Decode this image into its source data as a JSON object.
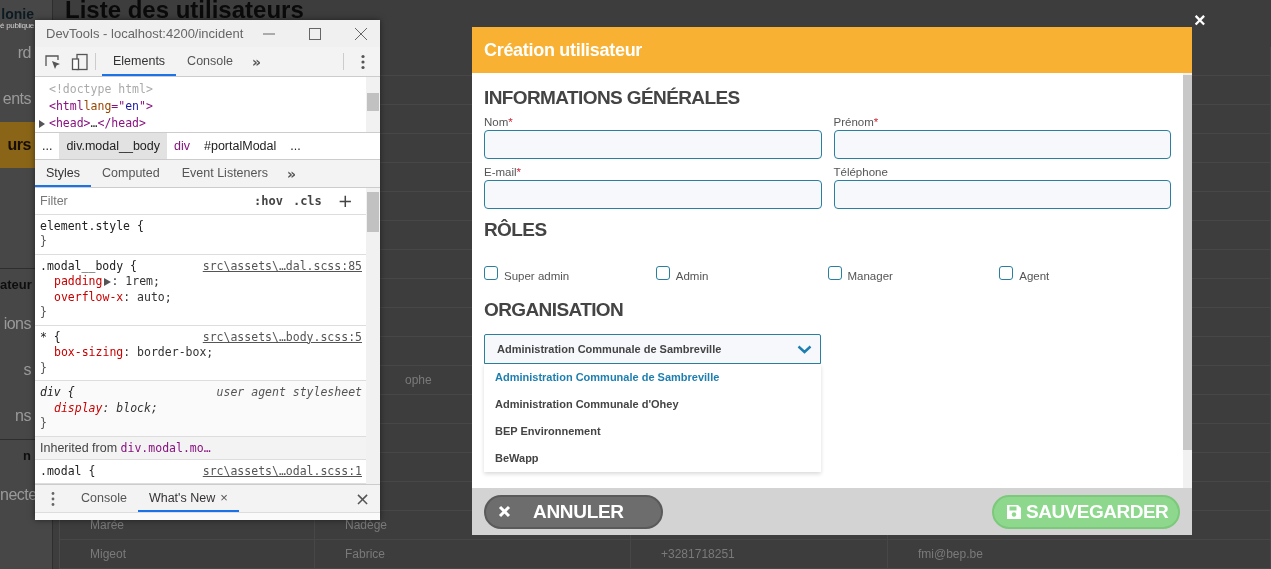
{
  "background_app": {
    "logo": "lonie",
    "logo_subtitle": "é publique",
    "page_title": "Liste des utilisateurs",
    "sidebar_sections": [
      {
        "items": [
          {
            "label": "rd",
            "selected": false
          },
          {
            "label": "ents",
            "selected": false
          },
          {
            "label": "urs",
            "selected": true
          }
        ]
      },
      {
        "heading": "ateur",
        "items": [
          {
            "label": "ions",
            "selected": false
          },
          {
            "label": "s",
            "selected": false
          },
          {
            "label": "ns",
            "selected": false
          }
        ]
      },
      {
        "heading": "n",
        "items": [
          {
            "label": "necte",
            "selected": false
          }
        ]
      }
    ],
    "table_rows": [
      {},
      {},
      {},
      {},
      {},
      {},
      {},
      {},
      {},
      {},
      {},
      {
        "column_2": "ophe"
      },
      {},
      {},
      {},
      {},
      {
        "column_1": "Marée",
        "column_2": "Nadège"
      },
      {
        "column_1": "Migeot",
        "column_2": "Fabrice",
        "column_3": "+3281718251",
        "column_4": "fmi@bep.be"
      }
    ]
  },
  "devtools": {
    "title": "DevTools - localhost:4200/incident",
    "tabs": [
      {
        "label": "Elements",
        "selected": true
      },
      {
        "label": "Console",
        "selected": false
      }
    ],
    "more": "»",
    "dom_lines": [
      [
        {
          "text": "<!doctype html>",
          "kind": "doctype"
        }
      ],
      [
        {
          "text": "<html",
          "kind": "tag"
        },
        {
          "text": " lang",
          "kind": "attr"
        },
        {
          "text": "=\"",
          "kind": "tag"
        },
        {
          "text": "en",
          "kind": "value"
        },
        {
          "text": "\">",
          "kind": "tag"
        }
      ],
      [
        {
          "text": "<head>",
          "kind": "tag"
        },
        {
          "text": "…",
          "kind": "plain"
        },
        {
          "text": "</head>",
          "kind": "tag"
        }
      ]
    ],
    "breadcrumb": [
      {
        "label": "...",
        "selected": false,
        "kind": "plain"
      },
      {
        "label": "div.modal__body",
        "selected": true,
        "kind": "plain"
      },
      {
        "label": "div",
        "selected": false,
        "kind": "tag"
      },
      {
        "label": "#portalModal",
        "selected": false,
        "kind": "plain"
      },
      {
        "label": "...",
        "selected": false,
        "kind": "plain"
      }
    ],
    "style_tabs": [
      {
        "label": "Styles",
        "selected": true
      },
      {
        "label": "Computed",
        "selected": false
      },
      {
        "label": "Event Listeners",
        "selected": false
      }
    ],
    "style_more": "»",
    "filter_placeholder": "Filter",
    "hov": ":hov",
    "cls": ".cls",
    "add": "+",
    "rules": [
      {
        "kind": "rule",
        "selector": "element.style {",
        "close": "}"
      },
      {
        "kind": "rule",
        "selector": ".modal__body {",
        "source": "src\\assets\\…dal.scss:85",
        "properties": [
          {
            "name": "padding",
            "value": ": 1rem;",
            "expandable": true
          },
          {
            "name": "overflow-x",
            "value": ": auto;",
            "expandable": false
          }
        ],
        "close": "}"
      },
      {
        "kind": "rule",
        "selector": "* {",
        "source": "src\\assets\\…body.scss:5",
        "properties": [
          {
            "name": "box-sizing",
            "value": ": border-box;",
            "expandable": false
          }
        ],
        "close": "}"
      },
      {
        "kind": "agent",
        "selector": "div {",
        "source": "user agent stylesheet",
        "properties": [
          {
            "name": "display",
            "value": ": block;",
            "expandable": false
          }
        ],
        "close": "}"
      },
      {
        "kind": "inherited",
        "label": "Inherited from ",
        "selector": "div.modal.mo…"
      },
      {
        "kind": "rule",
        "selector": ".modal {",
        "source": "src\\assets\\…odal.scss:1"
      }
    ],
    "drawer_tabs": [
      {
        "label": "Console",
        "selected": false
      },
      {
        "label": "What's New",
        "selected": true,
        "closable": true
      }
    ],
    "drawer_tab_close": "×",
    "drawer_close": "×"
  },
  "modal": {
    "outer_close": "×",
    "title": "Création utilisateur",
    "required_mark": "*",
    "general": {
      "heading": "INFORMATIONS GÉNÉRALES",
      "fields": [
        {
          "label": "Nom",
          "required": true
        },
        {
          "label": "Prénom",
          "required": true
        },
        {
          "label": "E-mail",
          "required": true
        },
        {
          "label": "Téléphone",
          "required": false
        }
      ]
    },
    "roles": {
      "heading": "RÔLES",
      "items": [
        {
          "label": "Super admin",
          "checked": false
        },
        {
          "label": "Admin",
          "checked": false
        },
        {
          "label": "Manager",
          "checked": false
        },
        {
          "label": "Agent",
          "checked": false
        }
      ]
    },
    "organisation": {
      "heading": "ORGANISATION",
      "value": "Administration Communale de Sambreville",
      "expanded": true,
      "options": [
        {
          "label": "Administration Communale de Sambreville",
          "selected": true
        },
        {
          "label": "Administration Communale d'Ohey",
          "selected": false
        },
        {
          "label": "BEP Environnement",
          "selected": false
        },
        {
          "label": "BeWapp",
          "selected": false
        }
      ]
    },
    "cancel": "ANNULER",
    "save": "SAUVEGARDER"
  }
}
